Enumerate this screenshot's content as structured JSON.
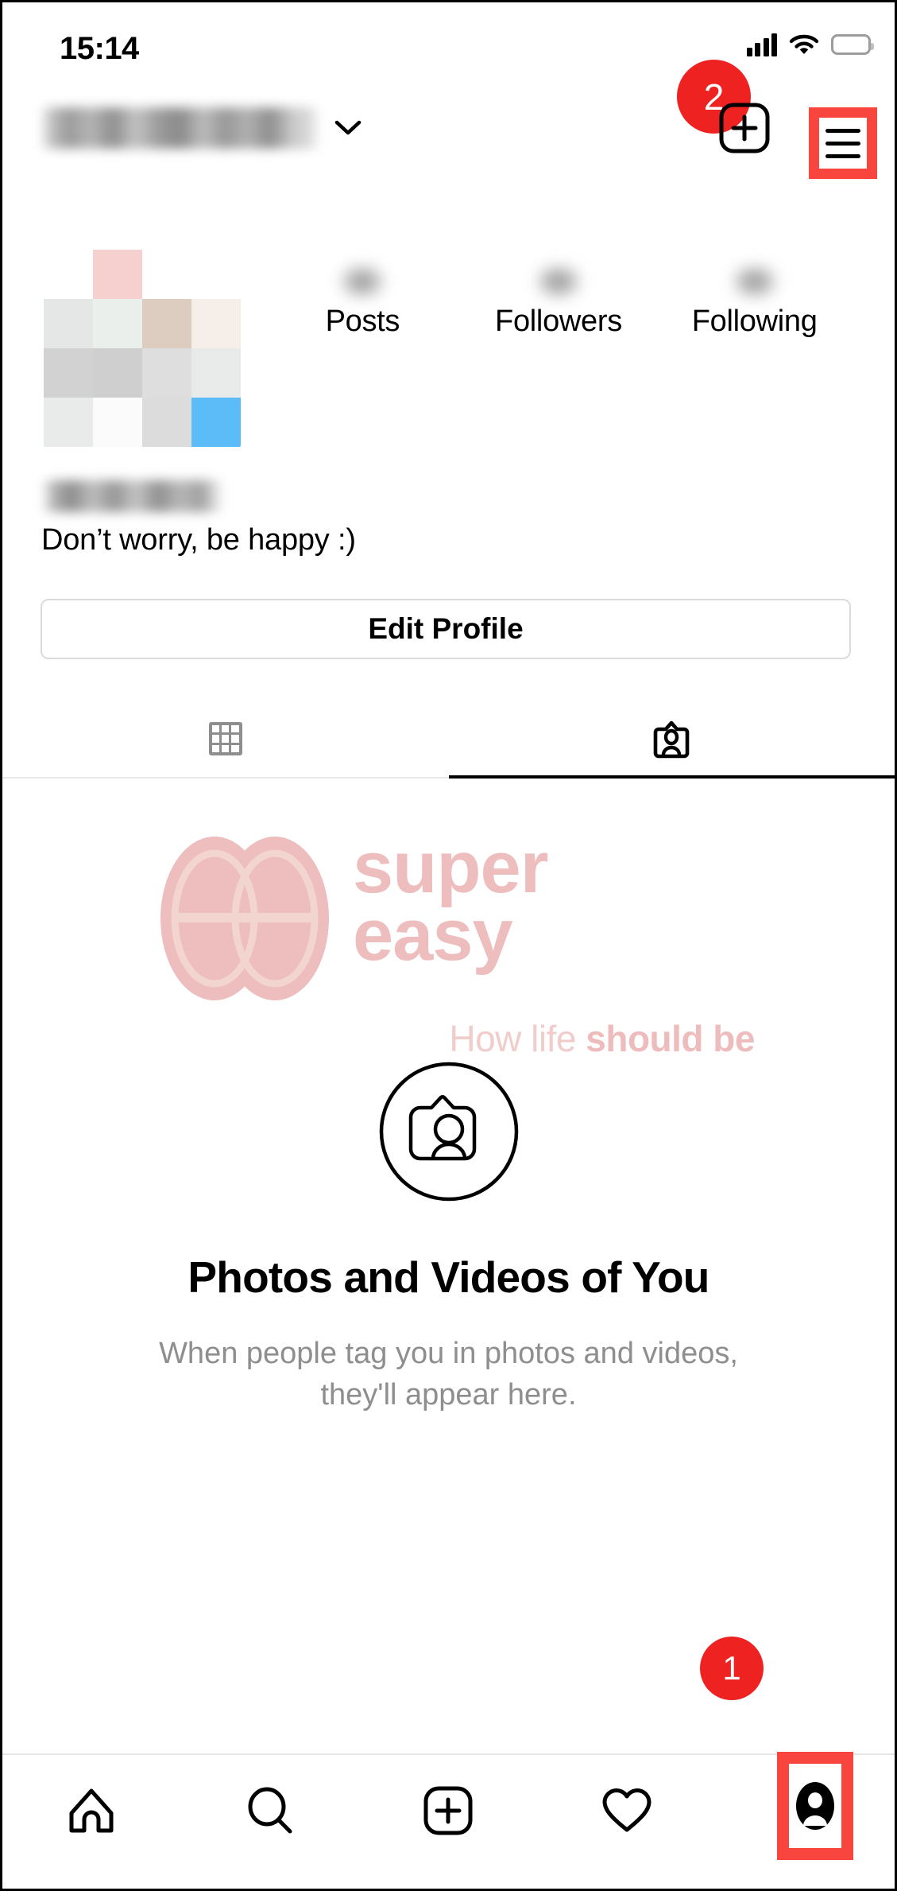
{
  "status_bar": {
    "time": "15:14",
    "cellular_icon": "cellular-signal-icon",
    "wifi_icon": "wifi-icon",
    "battery_icon": "battery-icon"
  },
  "header": {
    "username": "",
    "username_redacted": true,
    "chevron_icon": "chevron-down-icon",
    "add_post_icon": "plus-square-icon",
    "menu_icon": "hamburger-menu-icon"
  },
  "annotations": {
    "badge_one": "1",
    "badge_two": "2",
    "highlight_color": "#f8463f",
    "badge_color": "#ef2222"
  },
  "profile": {
    "avatar": "profile-picture-pixelated",
    "full_name": "",
    "full_name_redacted": true,
    "bio": "Don’t worry, be happy :)",
    "edit_profile_label": "Edit Profile",
    "stats": [
      {
        "label": "Posts",
        "value": "",
        "redacted": true
      },
      {
        "label": "Followers",
        "value": "",
        "redacted": true
      },
      {
        "label": "Following",
        "value": "",
        "redacted": true
      }
    ]
  },
  "tabs": [
    {
      "name": "grid",
      "icon": "grid-icon",
      "active": false
    },
    {
      "name": "tagged",
      "icon": "tagged-person-icon",
      "active": true
    }
  ],
  "watermark": {
    "line1": "super",
    "line2": "easy",
    "tagline_light": "How life ",
    "tagline_bold": "should be",
    "logo_icon": "supereasy-infinity-logo",
    "color": "#eebdbd"
  },
  "empty_state": {
    "icon": "tagged-photos-circle-icon",
    "title": "Photos and Videos of You",
    "subtitle_line1": "When people tag you in photos and videos,",
    "subtitle_line2": "they'll appear here."
  },
  "bottom_nav": [
    {
      "name": "home",
      "icon": "home-icon",
      "active": false
    },
    {
      "name": "search",
      "icon": "search-icon",
      "active": false
    },
    {
      "name": "create",
      "icon": "plus-square-icon",
      "active": false
    },
    {
      "name": "activity",
      "icon": "heart-icon",
      "active": false
    },
    {
      "name": "profile",
      "icon": "profile-avatar-icon",
      "active": true
    }
  ]
}
